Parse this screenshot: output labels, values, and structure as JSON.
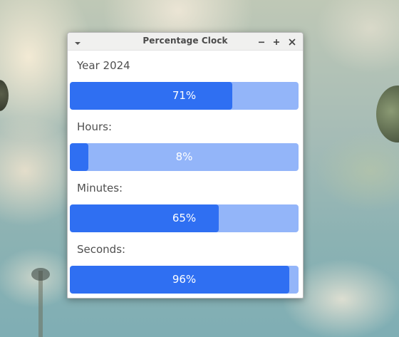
{
  "window": {
    "title": "Percentage Clock"
  },
  "rows": [
    {
      "label": "Year 2024",
      "percent": 71,
      "percent_text": "71%"
    },
    {
      "label": "Hours:",
      "percent": 8,
      "percent_text": "8%"
    },
    {
      "label": "Minutes:",
      "percent": 65,
      "percent_text": "65%"
    },
    {
      "label": "Seconds:",
      "percent": 96,
      "percent_text": "96%"
    }
  ],
  "colors": {
    "bar_fill": "#2f6ff2",
    "bar_track": "#93b5f9",
    "label_text": "#4f4f4f"
  },
  "icons": {
    "window_menu": "chevron-down-icon",
    "minimize": "minimize-icon",
    "maximize": "maximize-icon",
    "close": "close-icon"
  }
}
